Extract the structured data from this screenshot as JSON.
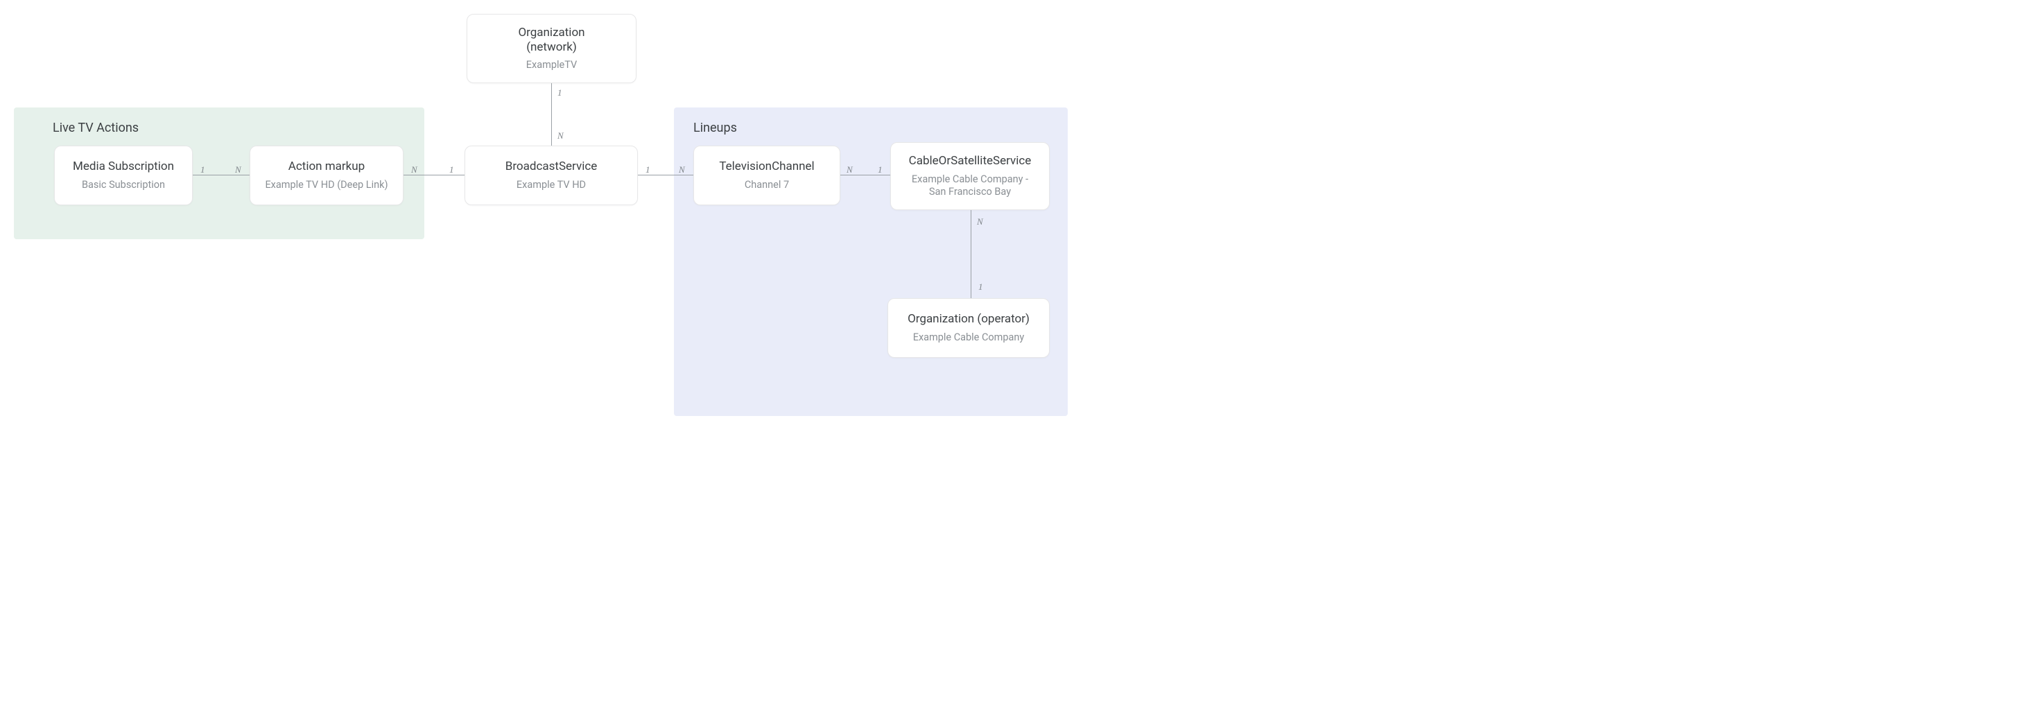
{
  "regions": {
    "live": {
      "title": "Live TV Actions"
    },
    "lineups": {
      "title": "Lineups"
    }
  },
  "nodes": {
    "mediaSubscription": {
      "title": "Media Subscription",
      "sub": "Basic Subscription"
    },
    "actionMarkup": {
      "title": "Action markup",
      "sub": "Example TV HD (Deep Link)"
    },
    "organizationNet": {
      "title": "Organization\n(network)",
      "sub": "ExampleTV"
    },
    "broadcastService": {
      "title": "BroadcastService",
      "sub": "Example TV HD"
    },
    "televisionChannel": {
      "title": "TelevisionChannel",
      "sub": "Channel 7"
    },
    "cableService": {
      "title": "CableOrSatelliteService",
      "sub": "Example Cable Company - San Francisco Bay"
    },
    "organizationOp": {
      "title": "Organization (operator)",
      "sub": "Example Cable Company"
    }
  },
  "cardinality": {
    "one": "1",
    "many": "N"
  }
}
